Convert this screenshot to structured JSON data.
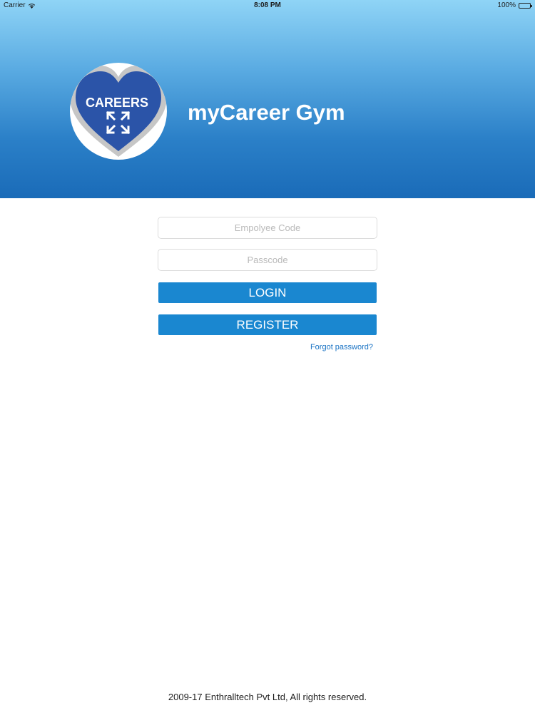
{
  "status_bar": {
    "carrier": "Carrier",
    "time": "8:08 PM",
    "battery": "100%"
  },
  "header": {
    "logo_text": "CAREERS",
    "title": "myCareer Gym"
  },
  "form": {
    "employee_code_placeholder": "Empolyee Code",
    "passcode_placeholder": "Passcode",
    "login_label": "LOGIN",
    "register_label": "REGISTER",
    "forgot_password": "Forgot password?"
  },
  "footer": {
    "copyright": "2009-17 Enthralltech Pvt Ltd, All rights reserved."
  },
  "colors": {
    "primary_button": "#1a87d0",
    "header_top": "#8fd4f6",
    "header_bottom": "#1a6bb8",
    "logo_heart": "#2b54a8",
    "link": "#1a73c4"
  }
}
